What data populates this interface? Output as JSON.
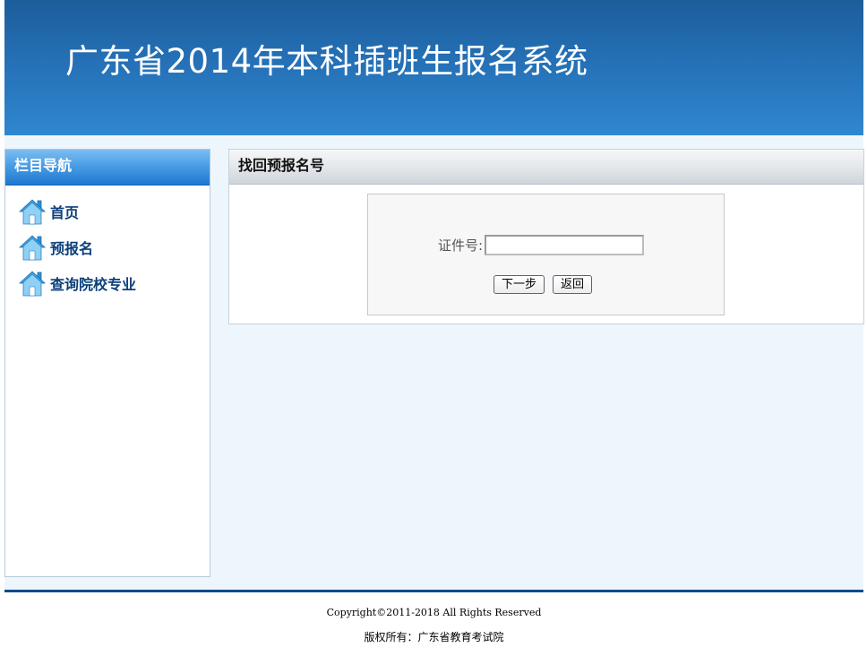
{
  "banner": {
    "title": "广东省2014年本科插班生报名系统"
  },
  "sidebar": {
    "header": "栏目导航",
    "items": [
      {
        "label": "首页",
        "icon": "home-icon"
      },
      {
        "label": "预报名",
        "icon": "home-icon"
      },
      {
        "label": "查询院校专业",
        "icon": "home-icon"
      }
    ]
  },
  "panel": {
    "title": "找回预报名号",
    "form": {
      "id_label": "证件号:",
      "id_value": "",
      "next_button": "下一步",
      "back_button": "返回"
    }
  },
  "footer": {
    "copyright": "Copyright©2011-2018 All Rights Reserved",
    "owner": "版权所有：广东省教育考试院"
  },
  "colors": {
    "banner": "#2570b6",
    "content_bg": "#eef6fd",
    "nav_text": "#0a3f7a",
    "footer_line": "#0a4a8c"
  }
}
